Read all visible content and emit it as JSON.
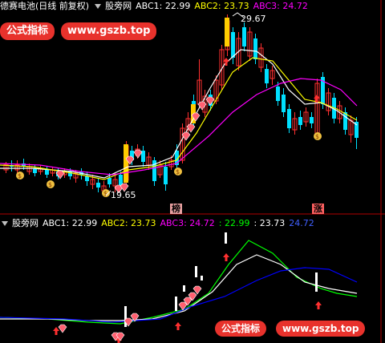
{
  "top_panel": {
    "title": "德赛电池(日线 前复权)",
    "indicator_name": "股旁网",
    "abc1_label": "ABC1: 22.99",
    "abc2_label": "ABC2: 23.73",
    "abc3_label": "ABC3: 24.72",
    "high_price": "29.67",
    "low_price": "19.65",
    "tag_bang": "榜",
    "tag_zhang": "涨"
  },
  "bottom_panel": {
    "indicator_name": "股旁网",
    "abc1_label": "ABC1: 22.99",
    "abc2_label": "ABC2: 23.73",
    "abc3_label": "ABC3: 24.72",
    "val1": ": 22.99",
    "val2": ": 23.73",
    "val3": "24.72"
  },
  "watermark": {
    "brand": "公式指标",
    "url": "www.gszb.top"
  },
  "colors": {
    "up": "#ff3030",
    "down": "#00e0ff",
    "abc1": "#ffffff",
    "abc2": "#ffff00",
    "abc3": "#ff00ff",
    "green_line": "#00ff00",
    "blue_line": "#0000ff",
    "gold": "#ffcc00"
  },
  "icons": [
    "money-bag-icon",
    "gem-icon",
    "up-arrow-icon"
  ]
}
